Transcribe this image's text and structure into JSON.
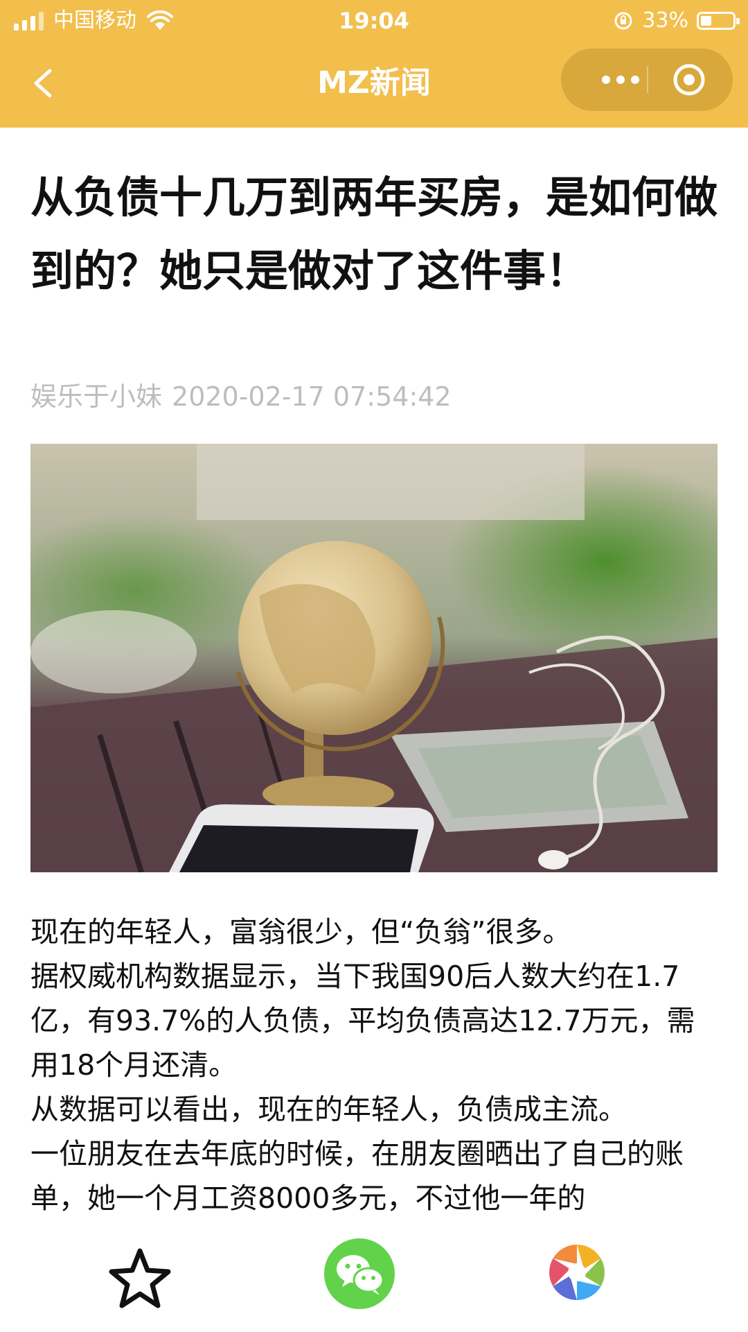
{
  "status_bar": {
    "carrier": "中国移动",
    "time": "19:04",
    "battery_percent": "33%",
    "battery_level": 0.33,
    "icons": [
      "signal-icon",
      "wifi-icon",
      "orientation-lock-icon",
      "battery-icon"
    ]
  },
  "nav": {
    "title": "MZ新闻",
    "icons": [
      "back-arrow-icon",
      "more-dots-icon",
      "close-target-icon"
    ]
  },
  "article": {
    "title": "从负债十几万到两年买房，是如何做到的？她只是做对了这件事！",
    "author": "娱乐于小妹",
    "date": "2020-02-17 07:54:42",
    "image": "photo: desk globe, smartphone, dollar bills and earphones on wooden table",
    "paragraphs": [
      "现在的年轻人，富翁很少，但“负翁”很多。",
      "据权威机构数据显示，当下我国90后人数大约在1.7亿，有93.7%的人负债，平均负债高达12.7万元，需用18个月还清。",
      "从数据可以看出，现在的年轻人，负债成主流。",
      "一位朋友在去年底的时候，在朋友圈晒出了自己的账单，她一个月工资8000多元，不过他一年的"
    ]
  },
  "bottom_bar": {
    "icons": [
      "star-icon",
      "wechat-icon",
      "moments-icon"
    ]
  },
  "colors": {
    "header": "#f2be4c",
    "meta_text": "#bdbdbd",
    "wechat_green": "#62d24b"
  }
}
